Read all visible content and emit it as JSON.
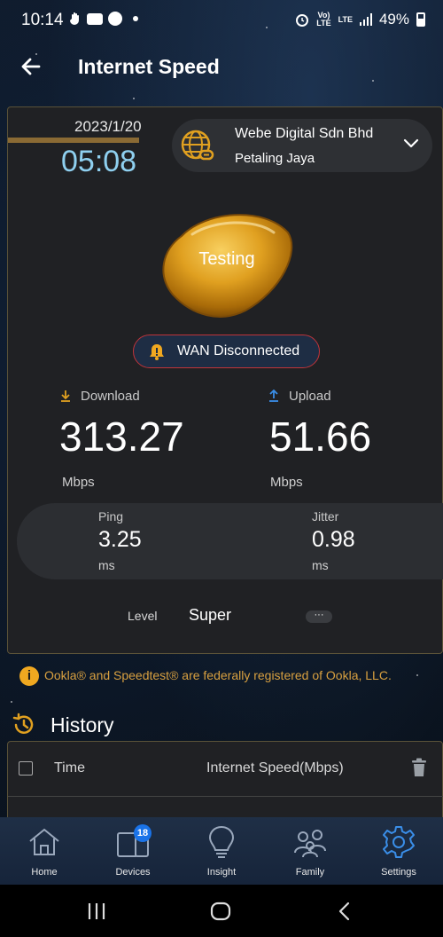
{
  "status_bar": {
    "time": "10:14",
    "battery": "49%",
    "volte": "Vo) LTE",
    "lte": "LTE"
  },
  "header": {
    "title": "Internet Speed"
  },
  "speedtest": {
    "date": "2023/1/20",
    "clock": "05:08",
    "isp_name": "Webe Digital Sdn Bhd",
    "isp_city": "Petaling Jaya",
    "status_button": "Testing",
    "wan_status": "WAN Disconnected",
    "download_label": "Download",
    "download_value": "313.27",
    "download_unit": "Mbps",
    "upload_label": "Upload",
    "upload_value": "51.66",
    "upload_unit": "Mbps",
    "ping_label": "Ping",
    "ping_value": "3.25",
    "ping_unit": "ms",
    "jitter_label": "Jitter",
    "jitter_value": "0.98",
    "jitter_unit": "ms",
    "level_label": "Level",
    "level_value": "Super",
    "more_label": "···"
  },
  "notice": {
    "icon": "i",
    "text": "Ookla® and Speedtest® are federally registered of Ookla, LLC."
  },
  "history": {
    "title": "History",
    "col_time": "Time",
    "col_speed": "Internet Speed(Mbps)"
  },
  "bottom_nav": {
    "items": [
      {
        "label": "Home",
        "icon": "home-icon"
      },
      {
        "label": "Devices",
        "icon": "devices-icon",
        "badge": "18"
      },
      {
        "label": "Insight",
        "icon": "lightbulb-icon"
      },
      {
        "label": "Family",
        "icon": "family-icon"
      },
      {
        "label": "Settings",
        "icon": "gear-icon"
      }
    ]
  },
  "colors": {
    "accent_gold": "#e0a020",
    "clock_blue": "#8fd0f0",
    "wan_border": "#c0343a",
    "notice_text": "#d8a040",
    "settings_active": "#3a8ee8"
  }
}
